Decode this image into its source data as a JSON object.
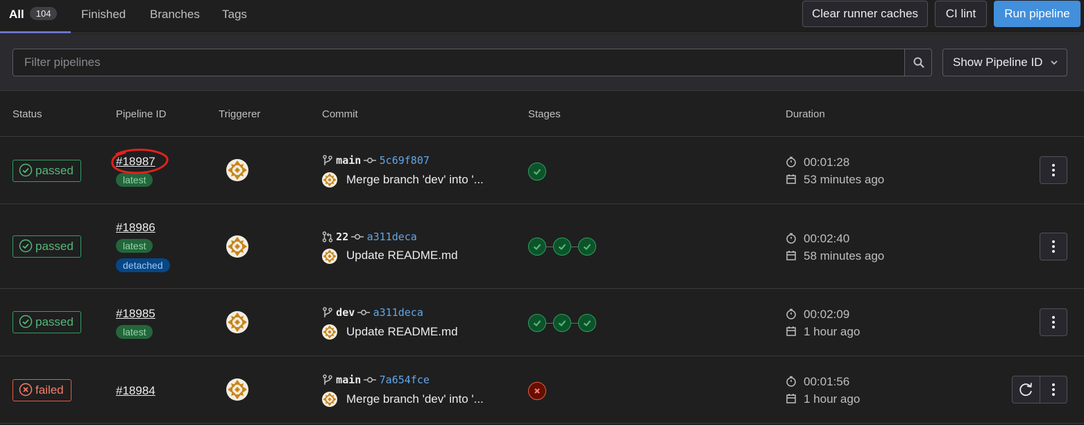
{
  "tabs": [
    {
      "label": "All",
      "count": "104"
    },
    {
      "label": "Finished"
    },
    {
      "label": "Branches"
    },
    {
      "label": "Tags"
    }
  ],
  "actions": {
    "clear_caches": "Clear runner caches",
    "ci_lint": "CI lint",
    "run_pipeline": "Run pipeline"
  },
  "filter": {
    "placeholder": "Filter pipelines",
    "dropdown_label": "Show Pipeline ID"
  },
  "columns": [
    "Status",
    "Pipeline ID",
    "Triggerer",
    "Commit",
    "Stages",
    "Duration"
  ],
  "rows": [
    {
      "status": "passed",
      "pipeline_id": "#18987",
      "badges": [
        "latest"
      ],
      "ref_type": "branch",
      "ref": "main",
      "sha": "5c69f807",
      "commit_title": "Merge branch 'dev' into '...",
      "stages": [
        "success"
      ],
      "duration": "00:01:28",
      "finished": "53 minutes ago"
    },
    {
      "status": "passed",
      "pipeline_id": "#18986",
      "badges": [
        "latest",
        "detached"
      ],
      "ref_type": "merge-request",
      "ref": "22",
      "sha": "a311deca",
      "commit_title": "Update README.md",
      "stages": [
        "success",
        "success",
        "success"
      ],
      "duration": "00:02:40",
      "finished": "58 minutes ago"
    },
    {
      "status": "passed",
      "pipeline_id": "#18985",
      "badges": [
        "latest"
      ],
      "ref_type": "branch",
      "ref": "dev",
      "sha": "a311deca",
      "commit_title": "Update README.md",
      "stages": [
        "success",
        "success",
        "success"
      ],
      "duration": "00:02:09",
      "finished": "1 hour ago"
    },
    {
      "status": "failed",
      "pipeline_id": "#18984",
      "badges": [],
      "ref_type": "branch",
      "ref": "main",
      "sha": "7a654fce",
      "commit_title": "Merge branch 'dev' into '...",
      "stages": [
        "failed"
      ],
      "duration": "00:01:56",
      "finished": "1 hour ago"
    }
  ],
  "icons": {
    "status_passed": "check-circle-icon",
    "status_failed": "x-circle-icon",
    "branch": "branch-icon",
    "merge_request": "merge-request-icon",
    "commit": "commit-icon",
    "duration": "timer-icon",
    "finished": "calendar-icon",
    "more": "kebab-icon",
    "retry": "retry-icon"
  },
  "colors": {
    "accent": "#428fdc",
    "passed": "#2da160",
    "failed": "#ec5941",
    "annotation": "#e0221d"
  }
}
